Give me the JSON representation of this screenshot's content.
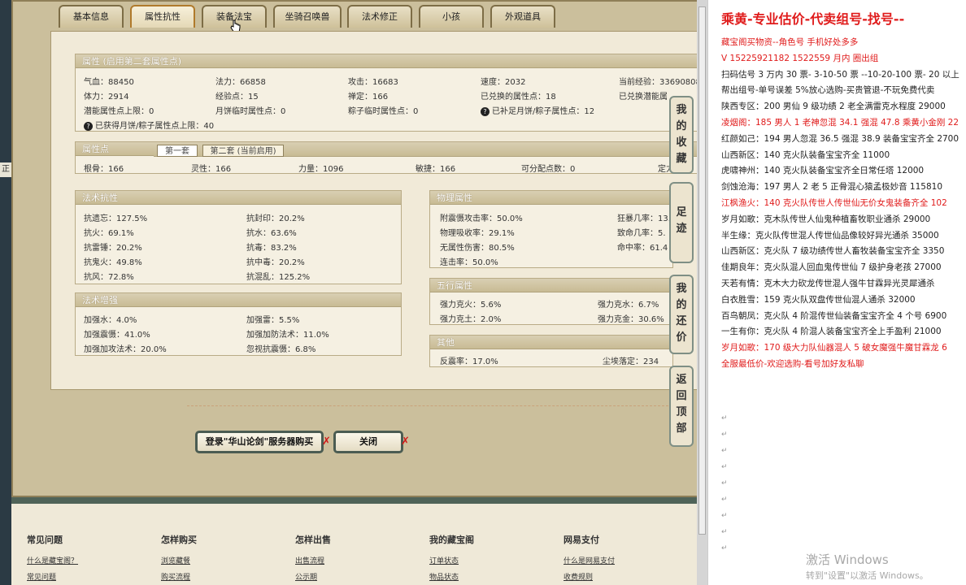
{
  "tabs": [
    "基本信息",
    "属性抗性",
    "装备法宝",
    "坐骑召唤兽",
    "法术修正",
    "小孩",
    "外观道具"
  ],
  "left_strip_label": "正",
  "attr": {
    "header": "属性 (启用第二套属性点)",
    "rows": [
      [
        "气血：88450",
        "法力：66858",
        "攻击：16683",
        "速度：2032",
        "当前经验：33690808"
      ],
      [
        "体力：2914",
        "经验点：15",
        "禅定：166",
        "已兑换的属性点：18",
        "已兑换潜能属"
      ],
      [
        "潜能属性点上限：0",
        "月饼临时属性点：0",
        "粽子临时属性点：0",
        "已补足月饼/粽子属性点：12",
        ""
      ]
    ],
    "note": "已获得月饼/粽子属性点上限：40",
    "icon": "?"
  },
  "points": {
    "header": "属性点",
    "subtab1": "第一套",
    "subtab2": "第二套 (当前启用)",
    "row": [
      "根骨：166",
      "灵性：166",
      "力量：1096",
      "敏捷：166",
      "可分配点数：0",
      "定力"
    ]
  },
  "resist": {
    "header": "法术抗性",
    "items": [
      "抗遗忘：127.5%",
      "抗封印：20.2%",
      "抗火：69.1%",
      "抗水：63.6%",
      "抗雷锤：20.2%",
      "抗毒：83.2%",
      "抗鬼火：49.8%",
      "抗中毒：20.2%",
      "抗风：72.8%",
      "抗混乱：125.2%"
    ]
  },
  "enhance": {
    "header": "法术增强",
    "items": [
      "加强水：4.0%",
      "加强雷：5.5%",
      "加强震慑：41.0%",
      "加强加防法术：11.0%",
      "加强加攻法术：20.0%",
      "忽视抗震慑：6.8%"
    ]
  },
  "phys": {
    "header": "物理属性",
    "items": [
      "附震慑攻击率：50.0%",
      "狂暴几率：13.",
      "物理吸收率：29.1%",
      "致命几率：5.",
      "无属性伤害：80.5%",
      "命中率：61.4",
      "连击率：50.0%",
      ""
    ]
  },
  "five": {
    "header": "五行属性",
    "items": [
      "强力克火：5.6%",
      "强力克水：6.7%",
      "强力克土：2.0%",
      "强力克金：30.6%"
    ]
  },
  "other": {
    "header": "其他",
    "items": [
      "反震率：17.0%",
      "尘埃落定：234"
    ]
  },
  "side_buttons": [
    "我的收藏",
    "足迹",
    "我的还价",
    "返回顶部"
  ],
  "buttons": {
    "login": "登录\"华山论剑\"服务器购买",
    "close": "关闭"
  },
  "footer": {
    "cols": [
      {
        "title": "常见问题",
        "links": [
          "什么是藏宝阁？",
          "常见问题"
        ]
      },
      {
        "title": "怎样购买",
        "links": [
          "浏览藏餐",
          "购买流程"
        ]
      },
      {
        "title": "怎样出售",
        "links": [
          "出售流程",
          "公示期"
        ]
      },
      {
        "title": "我的藏宝阁",
        "links": [
          "订单状态",
          "物品状态"
        ]
      },
      {
        "title": "网易支付",
        "links": [
          "什么是网易支付",
          "收费规则"
        ]
      }
    ]
  },
  "doc": {
    "title": "乘黄-专业估价-代卖组号-找号--",
    "lines": [
      {
        "t": "藏宝阁买物资--角色号 手机好处多多",
        "c": "red"
      },
      {
        "t": "V 15225921182 1522559 月内 圈出组",
        "c": "red"
      },
      {
        "t": "扫码估号 3 万内 30 票- 3-10-50 票 --10-20-100 票- 20 以上",
        "c": ""
      },
      {
        "t": "帮出组号-单号误差 5%放心选购-买贵管退-不玩免费代卖",
        "c": ""
      },
      {
        "t": "陕西专区：200 男仙 9 级功绩 2 老全满雷克水程度 29000",
        "c": ""
      },
      {
        "t": "凌烟阁：185 男人 1 老神忽混 34.1 强混 47.8 乘黄小金刚 22",
        "c": "red"
      },
      {
        "t": "红颜如己：194 男人忽混 36.5 强混 38.9 装备宝宝齐全 2700",
        "c": ""
      },
      {
        "t": "山西新区：140 克火队装备宝宝齐全 11000",
        "c": ""
      },
      {
        "t": "虎啸神州：140 克火队装备宝宝齐全日常任塔 12000",
        "c": ""
      },
      {
        "t": "剑蚀沧海：197 男人 2 老 5 正骨混心猿孟极妙音 115810",
        "c": ""
      },
      {
        "t": "江枫渔火：140 克火队传世人传世仙无价女鬼装备齐全 102",
        "c": "red"
      },
      {
        "t": "岁月如歌：克木队传世人仙鬼种植畜牧职业通杀 29000",
        "c": ""
      },
      {
        "t": "半生缘：克火队传世混人传世仙品像较好异光通杀 35000",
        "c": ""
      },
      {
        "t": "山西新区：克火队 7 级功绩传世人畜牧装备宝宝齐全 3350",
        "c": ""
      },
      {
        "t": "佳期良年：克火队混人回血鬼传世仙 7 级护身老孩 27000",
        "c": ""
      },
      {
        "t": "天若有情：克木大力砍龙传世混人强牛甘霖异光灵犀通杀",
        "c": ""
      },
      {
        "t": "白衣胜雪：159 克火队双盘传世仙混人通杀 32000",
        "c": ""
      },
      {
        "t": "百鸟朝凤：克火队 4 阶混传世仙装备宝宝齐全 4 个号 6900",
        "c": ""
      },
      {
        "t": "一生有你：克火队 4 阶混人装备宝宝齐全上手盈利 21000",
        "c": ""
      },
      {
        "t": "岁月如歌：170 级大力队仙器混人 5 破女魔强牛魔甘霖龙 6",
        "c": "red"
      },
      {
        "t": "全服最低价-欢迎选购-看号加好友私聊",
        "c": "red"
      }
    ],
    "watermark1": "激活 Windows",
    "watermark2": "转到\"设置\"以激活 Windows。"
  }
}
